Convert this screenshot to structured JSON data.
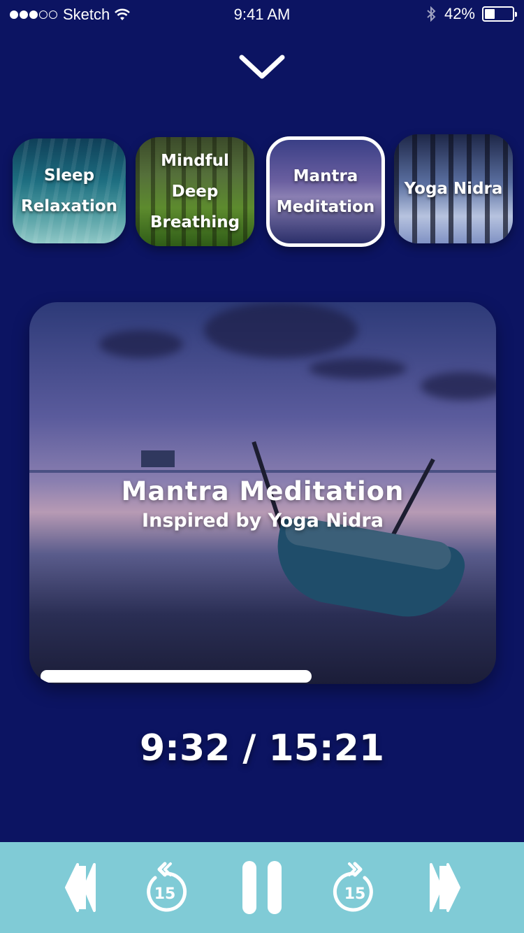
{
  "status_bar": {
    "carrier": "Sketch",
    "time": "9:41 AM",
    "battery_percent": "42%",
    "battery_level": 0.42,
    "signal_bars": 3,
    "signal_total": 5
  },
  "header": {
    "collapse_icon": "chevron-down-icon"
  },
  "tracks": [
    {
      "label": "Sleep\nRelaxation",
      "selected": false
    },
    {
      "label": "Mindful Deep\nBreathing",
      "selected": false
    },
    {
      "label": "Mantra\nMeditation",
      "selected": true
    },
    {
      "label": "Yoga Nidra",
      "selected": false
    }
  ],
  "now_playing": {
    "title": "Mantra Meditation",
    "subtitle": "Inspired by Yoga Nidra",
    "progress": 0.61,
    "time_readout": "9:32 / 15:21"
  },
  "controls": {
    "rewind_amount": "15",
    "forward_amount": "15",
    "icons": [
      "previous-track-icon",
      "rewind-15-icon",
      "pause-icon",
      "forward-15-icon",
      "next-track-icon"
    ],
    "background_color": "#80cbd6"
  },
  "colors": {
    "background": "#0c1462",
    "accent": "#ffffff"
  }
}
